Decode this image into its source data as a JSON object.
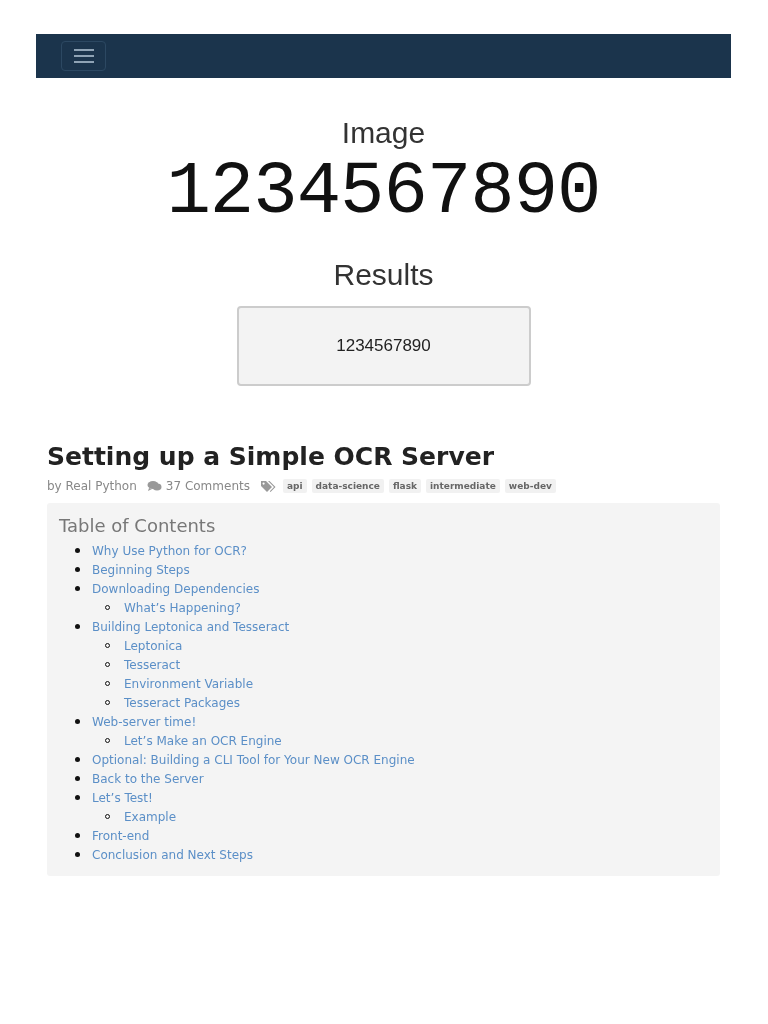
{
  "hero": {
    "image_heading": "Image",
    "digits": "1234567890",
    "results_heading": "Results",
    "result_value": "1234567890"
  },
  "article": {
    "title": "Setting up a Simple OCR Server",
    "author": "by Real Python",
    "comments": "37 Comments",
    "tags": [
      "api",
      "data-science",
      "flask",
      "intermediate",
      "web-dev"
    ]
  },
  "toc": {
    "title": "Table of Contents",
    "items": [
      {
        "label": "Why Use Python for OCR?"
      },
      {
        "label": "Beginning Steps"
      },
      {
        "label": "Downloading Dependencies",
        "children": [
          {
            "label": "What’s Happening?"
          }
        ]
      },
      {
        "label": "Building Leptonica and Tesseract",
        "children": [
          {
            "label": "Leptonica"
          },
          {
            "label": "Tesseract"
          },
          {
            "label": "Environment Variable"
          },
          {
            "label": "Tesseract Packages"
          }
        ]
      },
      {
        "label": "Web-server time!",
        "children": [
          {
            "label": "Let’s Make an OCR Engine"
          }
        ]
      },
      {
        "label": "Optional: Building a CLI Tool for Your New OCR Engine"
      },
      {
        "label": "Back to the Server"
      },
      {
        "label": "Let’s Test!",
        "children": [
          {
            "label": "Example"
          }
        ]
      },
      {
        "label": "Front-end"
      },
      {
        "label": "Conclusion and Next Steps"
      }
    ]
  }
}
